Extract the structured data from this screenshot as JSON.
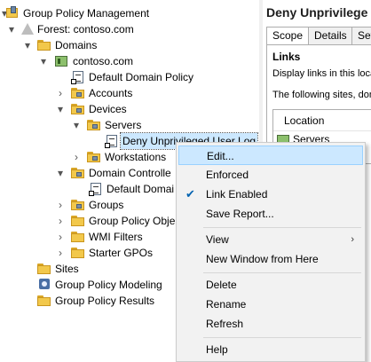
{
  "tree": {
    "items": [
      {
        "label": "Group Policy Management"
      },
      {
        "label": "Forest: contoso.com"
      },
      {
        "label": "Domains"
      },
      {
        "label": "contoso.com"
      },
      {
        "label": "Default Domain Policy"
      },
      {
        "label": "Accounts"
      },
      {
        "label": "Devices"
      },
      {
        "label": "Servers"
      },
      {
        "label": "Deny Unprivileged User Log"
      },
      {
        "label": "Workstations"
      },
      {
        "label": "Domain Controlle"
      },
      {
        "label": "Default Domai"
      },
      {
        "label": "Groups"
      },
      {
        "label": "Group Policy Obje"
      },
      {
        "label": "WMI Filters"
      },
      {
        "label": "Starter GPOs"
      },
      {
        "label": "Sites"
      },
      {
        "label": "Group Policy Modeling"
      },
      {
        "label": "Group Policy Results"
      }
    ]
  },
  "details": {
    "title": "Deny Unprivilege",
    "tabs": [
      "Scope",
      "Details",
      "Settir"
    ],
    "section": "Links",
    "display_links_text": "Display links in this loca",
    "following_text": "The following sites, dom",
    "column_location": "Location",
    "row_location": "Servers"
  },
  "context_menu": {
    "items": [
      {
        "label": "Edit..."
      },
      {
        "label": "Enforced"
      },
      {
        "label": "Link Enabled",
        "checked": true
      },
      {
        "label": "Save Report..."
      },
      {
        "label": "View",
        "submenu": true
      },
      {
        "label": "New Window from Here"
      },
      {
        "label": "Delete"
      },
      {
        "label": "Rename"
      },
      {
        "label": "Refresh"
      },
      {
        "label": "Help"
      }
    ],
    "highlighted": "Edit..."
  },
  "colors": {
    "selection": "#cce8ff",
    "menu_background": "#f2f2f2",
    "folder": "#f2c84b",
    "check": "#0063b1"
  }
}
